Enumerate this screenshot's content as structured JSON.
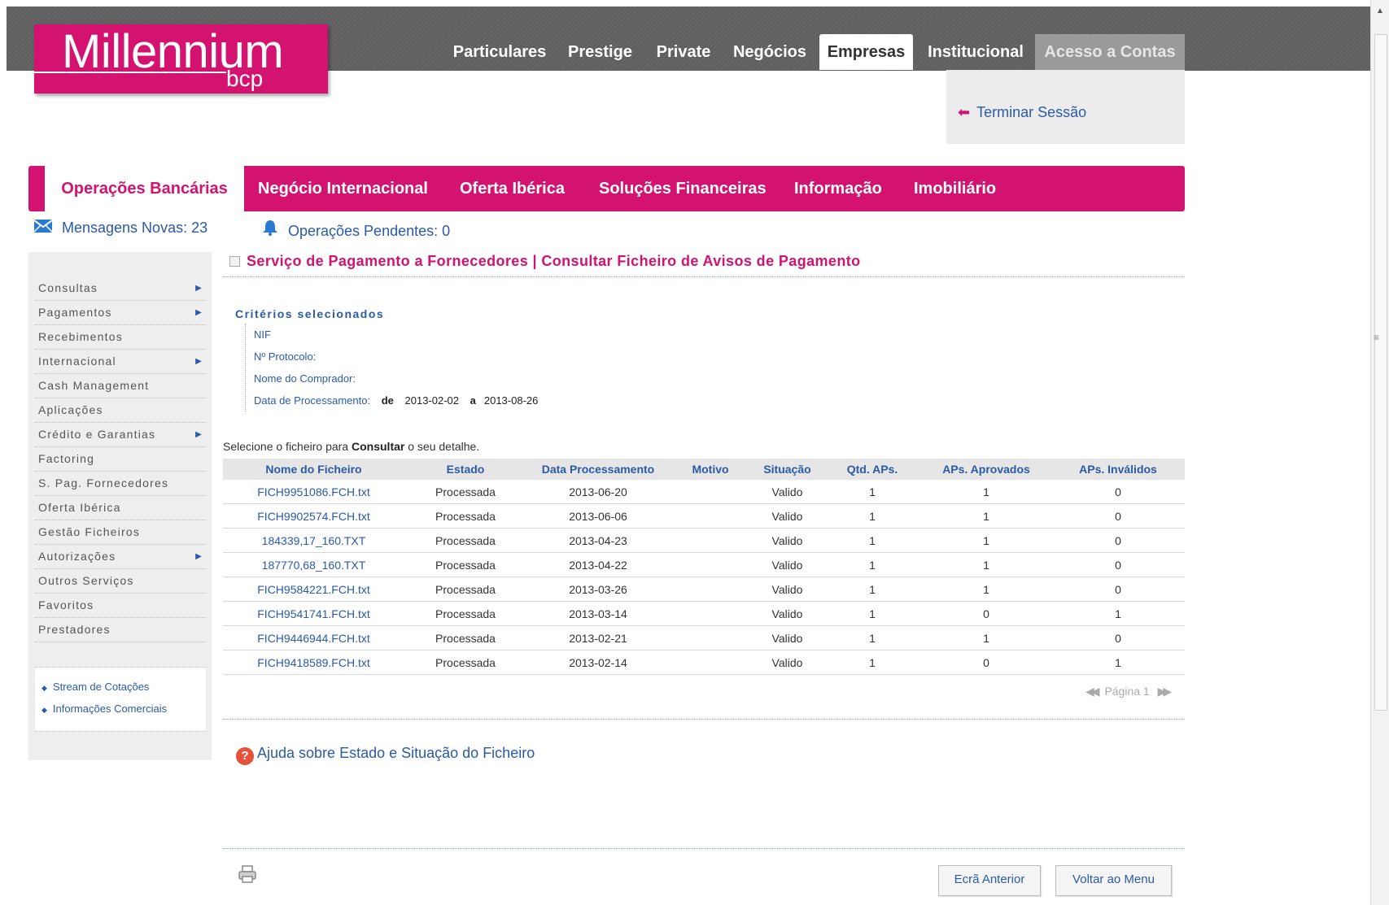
{
  "brand": {
    "name": "Millennium",
    "sub": "bcp",
    "color": "#d3136f"
  },
  "top_nav": [
    {
      "label": "Particulares"
    },
    {
      "label": "Prestige"
    },
    {
      "label": "Private"
    },
    {
      "label": "Negócios"
    },
    {
      "label": "Empresas",
      "active": true
    },
    {
      "label": "Institucional"
    },
    {
      "label": "Acesso a Contas"
    }
  ],
  "logout_label": "Terminar Sessão",
  "main_menu": [
    {
      "label": "Operações Bancárias",
      "active": true
    },
    {
      "label": "Negócio Internacional"
    },
    {
      "label": "Oferta Ibérica"
    },
    {
      "label": "Soluções Financeiras"
    },
    {
      "label": "Informação"
    },
    {
      "label": "Imobiliário"
    }
  ],
  "status": {
    "messages": "Mensagens Novas: 23",
    "pending": "Operações Pendentes: 0"
  },
  "sidebar": {
    "items": [
      {
        "label": "Consultas",
        "submenu": true
      },
      {
        "label": "Pagamentos",
        "submenu": true
      },
      {
        "label": "Recebimentos",
        "submenu": false
      },
      {
        "label": "Internacional",
        "submenu": true
      },
      {
        "label": "Cash Management",
        "submenu": false
      },
      {
        "label": "Aplicações",
        "submenu": false
      },
      {
        "label": "Crédito e Garantias",
        "submenu": true
      },
      {
        "label": "Factoring",
        "submenu": false
      },
      {
        "label": "S. Pag. Fornecedores",
        "submenu": false
      },
      {
        "label": "Oferta Ibérica",
        "submenu": false
      },
      {
        "label": "Gestão Ficheiros",
        "submenu": false
      },
      {
        "label": "Autorizações",
        "submenu": true
      },
      {
        "label": "Outros Serviços",
        "submenu": false
      },
      {
        "label": "Favoritos",
        "submenu": false
      },
      {
        "label": "Prestadores",
        "submenu": false
      }
    ],
    "links": [
      {
        "label": "Stream de Cotações"
      },
      {
        "label": "Informações Comerciais"
      }
    ]
  },
  "page_title": "Serviço de Pagamento a Fornecedores | Consultar Ficheiro de Avisos de Pagamento",
  "criteria": {
    "title": "Critérios selecionados",
    "nif_label": "NIF",
    "protocol_label": "Nº Protocolo:",
    "buyer_label": "Nome do Comprador:",
    "date_label": "Data de Processamento:",
    "date_from_word": "de",
    "date_from": "2013-02-02",
    "date_to_word": "a",
    "date_to": "2013-08-26"
  },
  "instruction": {
    "before": "Selecione o ficheiro para ",
    "bold": "Consultar",
    "after": " o seu detalhe."
  },
  "table": {
    "columns": [
      "Nome do Ficheiro",
      "Estado",
      "Data Processamento",
      "Motivo",
      "Situação",
      "Qtd. APs.",
      "APs. Aprovados",
      "APs. Inválidos"
    ],
    "rows": [
      [
        "FICH9951086.FCH.txt",
        "Processada",
        "2013-06-20",
        "",
        "Valido",
        "1",
        "1",
        "0"
      ],
      [
        "FICH9902574.FCH.txt",
        "Processada",
        "2013-06-06",
        "",
        "Valido",
        "1",
        "1",
        "0"
      ],
      [
        "184339,17_160.TXT",
        "Processada",
        "2013-04-23",
        "",
        "Valido",
        "1",
        "1",
        "0"
      ],
      [
        "187770,68_160.TXT",
        "Processada",
        "2013-04-22",
        "",
        "Valido",
        "1",
        "1",
        "0"
      ],
      [
        "FICH9584221.FCH.txt",
        "Processada",
        "2013-03-26",
        "",
        "Valido",
        "1",
        "1",
        "0"
      ],
      [
        "FICH9541741.FCH.txt",
        "Processada",
        "2013-03-14",
        "",
        "Valido",
        "1",
        "0",
        "1"
      ],
      [
        "FICH9446944.FCH.txt",
        "Processada",
        "2013-02-21",
        "",
        "Valido",
        "1",
        "1",
        "0"
      ],
      [
        "FICH9418589.FCH.txt",
        "Processada",
        "2013-02-14",
        "",
        "Valido",
        "1",
        "0",
        "1"
      ]
    ]
  },
  "pager": {
    "label": "Página 1"
  },
  "help_label": "Ajuda sobre Estado e Situação do Ficheiro",
  "buttons": {
    "previous": "Ecrã Anterior",
    "menu": "Voltar ao Menu"
  }
}
